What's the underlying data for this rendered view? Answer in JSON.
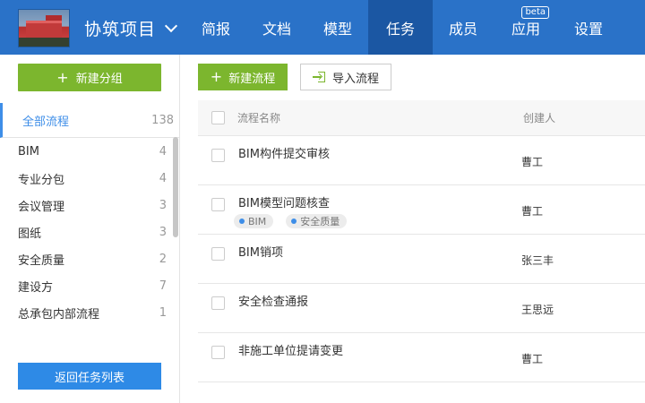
{
  "header": {
    "project_name": "协筑项目",
    "nav": [
      {
        "label": "简报",
        "active": false
      },
      {
        "label": "文档",
        "active": false
      },
      {
        "label": "模型",
        "active": false
      },
      {
        "label": "任务",
        "active": true
      },
      {
        "label": "成员",
        "active": false
      },
      {
        "label": "应用",
        "active": false,
        "badge": "beta"
      },
      {
        "label": "设置",
        "active": false
      }
    ]
  },
  "sidebar": {
    "new_group_label": "新建分组",
    "all": {
      "label": "全部流程",
      "count": "138"
    },
    "groups": [
      {
        "label": "BIM",
        "count": "4"
      },
      {
        "label": "专业分包",
        "count": "4"
      },
      {
        "label": "会议管理",
        "count": "3"
      },
      {
        "label": "图纸",
        "count": "3"
      },
      {
        "label": "安全质量",
        "count": "2"
      },
      {
        "label": "建设方",
        "count": "7"
      },
      {
        "label": "总承包内部流程",
        "count": "1"
      }
    ],
    "back_label": "返回任务列表"
  },
  "toolbar": {
    "new_flow_label": "新建流程",
    "import_label": "导入流程"
  },
  "table": {
    "columns": {
      "name": "流程名称",
      "creator": "创建人"
    },
    "rows": [
      {
        "name": "BIM构件提交审核",
        "creator": "曹工",
        "tags": []
      },
      {
        "name": "BIM模型问题核查",
        "creator": "曹工",
        "tags": [
          "BIM",
          "安全质量"
        ]
      },
      {
        "name": "BIM销项",
        "creator": "张三丰",
        "tags": []
      },
      {
        "name": "安全检查通报",
        "creator": "王思远",
        "tags": []
      },
      {
        "name": "非施工单位提请变更",
        "creator": "曹工",
        "tags": []
      }
    ]
  },
  "colors": {
    "header_bg": "#2a72c8",
    "nav_active_bg": "#1b57a3",
    "primary_green": "#7cb62e",
    "primary_blue": "#2e8ae6",
    "accent_blue": "#3e8ee8"
  }
}
